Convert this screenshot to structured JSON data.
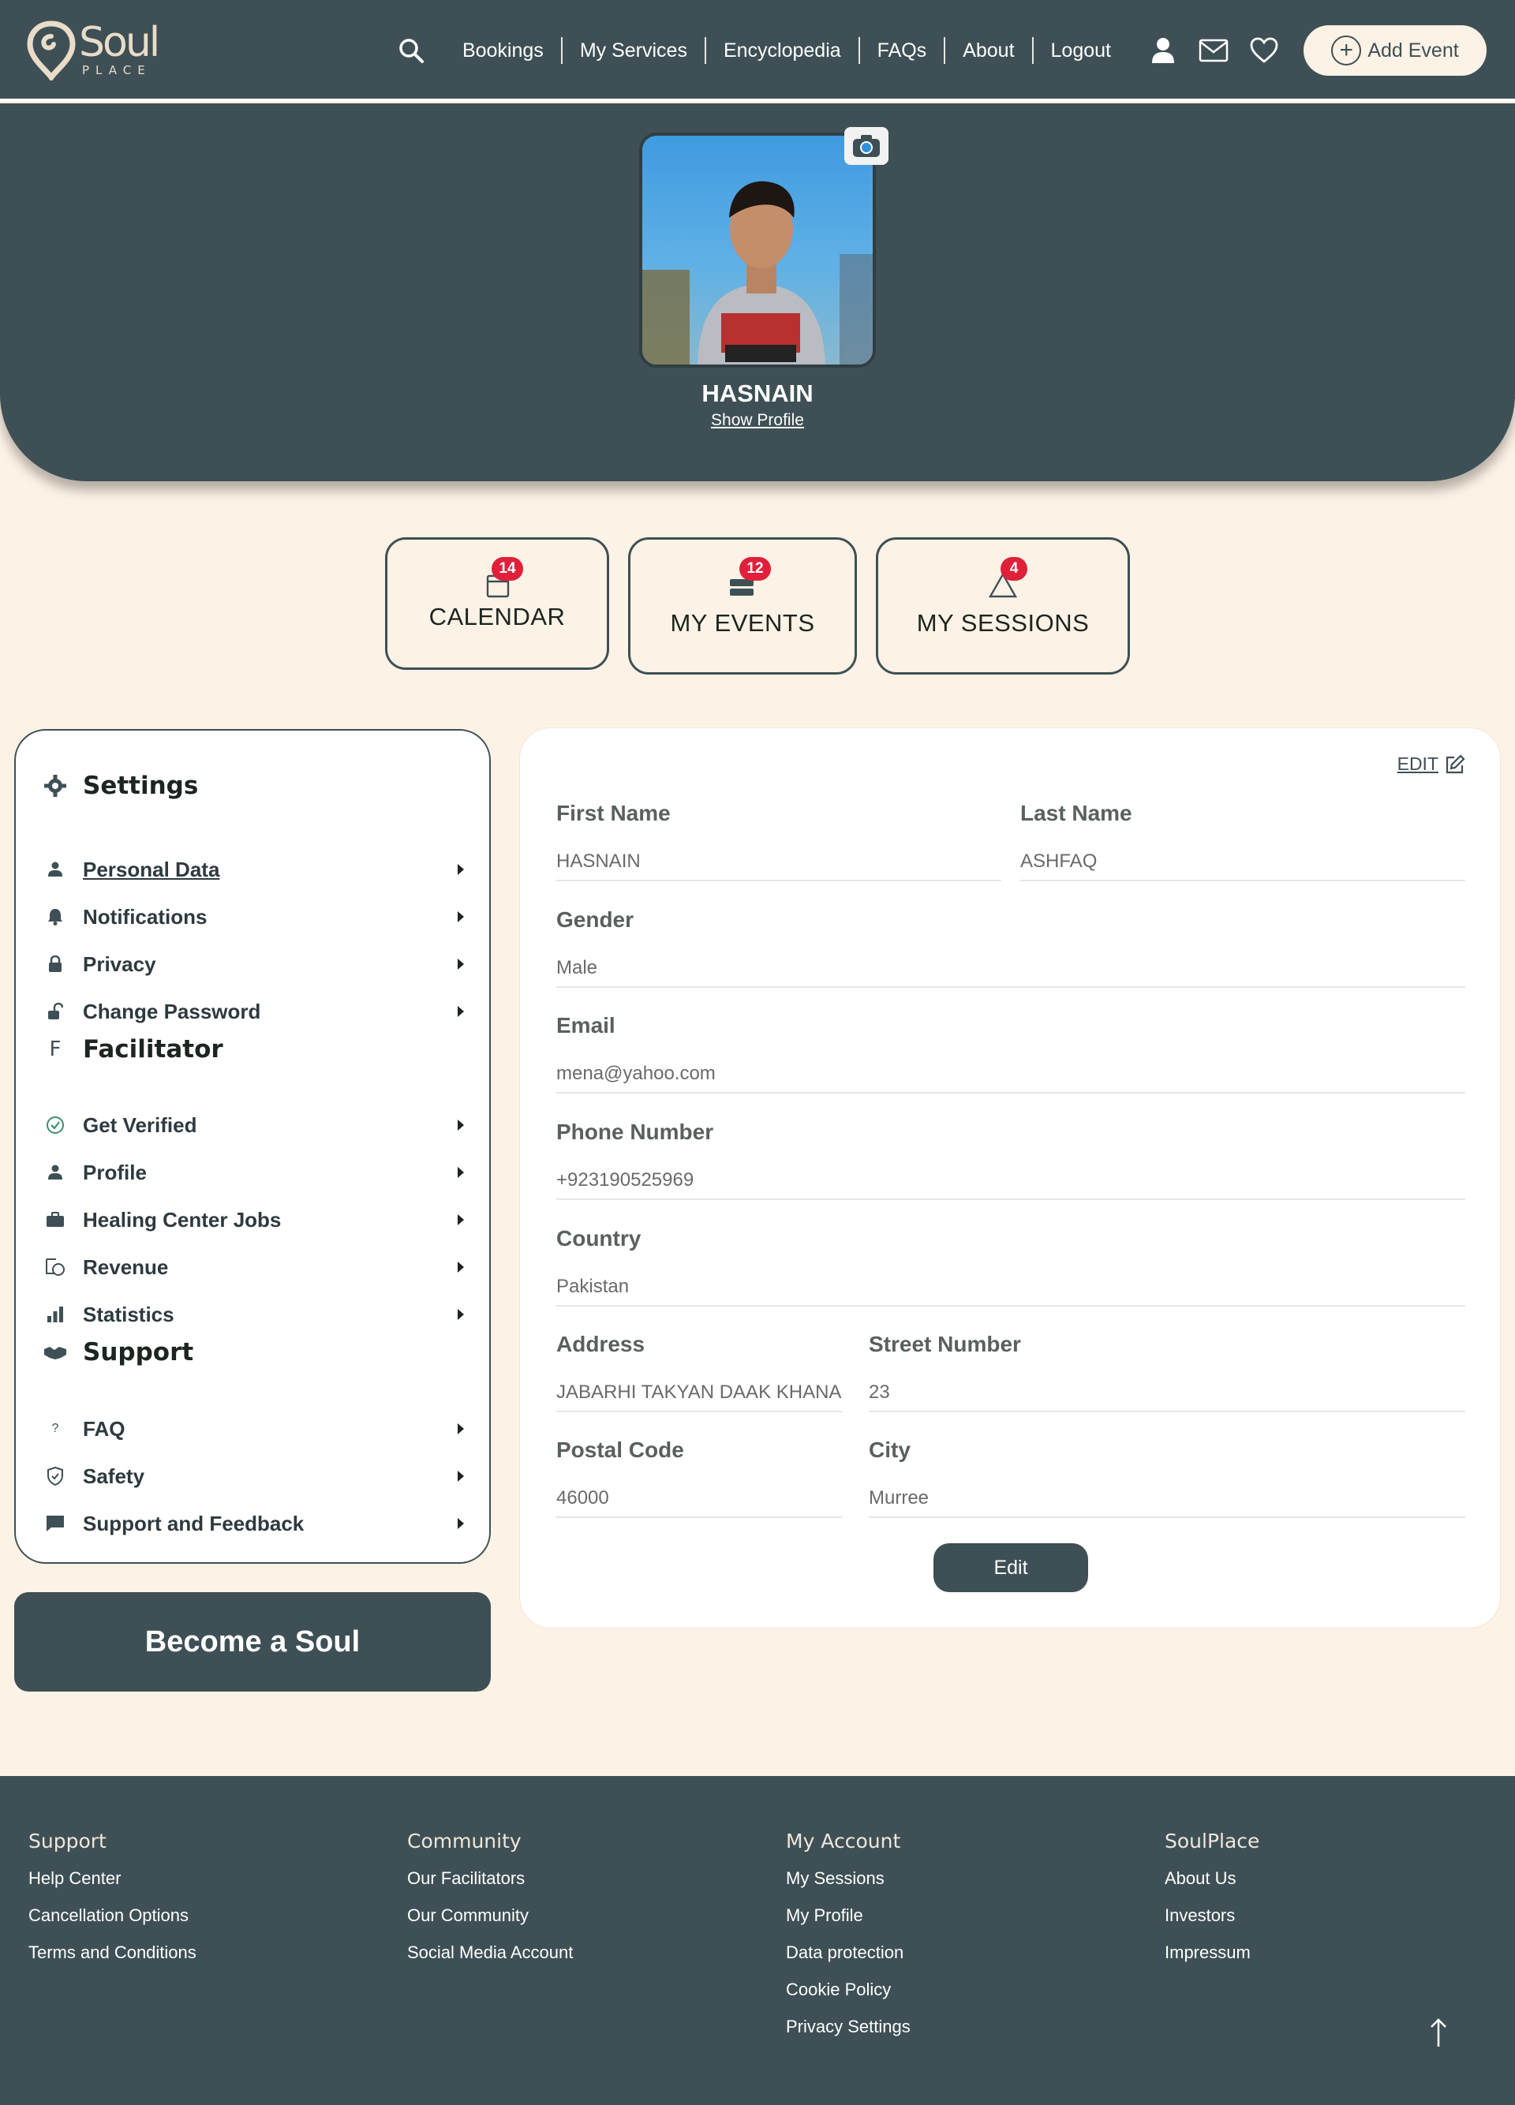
{
  "nav": {
    "logo": {
      "word": "Soul",
      "sub": "PLACE"
    },
    "links": [
      "Bookings",
      "My Services",
      "Encyclopedia",
      "FAQs",
      "About",
      "Logout"
    ],
    "add_event_label": "Add Event"
  },
  "profile": {
    "name": "HASNAIN",
    "show_profile": "Show Profile"
  },
  "stats": {
    "calendar": {
      "label": "CALENDAR",
      "count": "14"
    },
    "events": {
      "label": "MY EVENTS",
      "count": "12"
    },
    "sessions": {
      "label": "MY SESSIONS",
      "count": "4"
    }
  },
  "sidebar": {
    "settings": {
      "title": "Settings",
      "items": [
        "Personal Data",
        "Notifications",
        "Privacy",
        "Change Password"
      ]
    },
    "facilitator": {
      "title": "Facilitator",
      "icon_letter": "F",
      "items": [
        "Get Verified",
        "Profile",
        "Healing Center Jobs",
        "Revenue",
        "Statistics"
      ]
    },
    "support": {
      "title": "Support",
      "items": [
        "FAQ",
        "Safety",
        "Support and Feedback"
      ]
    },
    "faq_icon": "?"
  },
  "become_soul_label": "Become a Soul",
  "form": {
    "edit_link": "EDIT",
    "first_name": {
      "label": "First Name",
      "value": "HASNAIN"
    },
    "last_name": {
      "label": "Last Name",
      "value": "ASHFAQ"
    },
    "gender": {
      "label": "Gender",
      "value": "Male"
    },
    "email": {
      "label": "Email",
      "value": "mena@yahoo.com"
    },
    "phone": {
      "label": "Phone Number",
      "value": "+923190525969"
    },
    "country": {
      "label": "Country",
      "value": "Pakistan"
    },
    "address": {
      "label": "Address",
      "value": "JABARHI TAKYAN DAAK KHANA E"
    },
    "street": {
      "label": "Street Number",
      "value": "23"
    },
    "postal": {
      "label": "Postal Code",
      "value": "46000"
    },
    "city": {
      "label": "City",
      "value": "Murree"
    },
    "edit_button": "Edit"
  },
  "footer": {
    "support": {
      "title": "Support",
      "links": [
        "Help Center",
        "Cancellation Options",
        "Terms and Conditions"
      ]
    },
    "community": {
      "title": "Community",
      "links": [
        "Our Facilitators",
        "Our Community",
        "Social Media Account"
      ]
    },
    "account": {
      "title": "My Account",
      "links": [
        "My Sessions",
        "My Profile",
        "Data protection",
        "Cookie Policy",
        "Privacy Settings"
      ]
    },
    "soulplace": {
      "title": "SoulPlace",
      "links": [
        "About Us",
        "Investors",
        "Impressum"
      ]
    }
  },
  "colors": {
    "primary": "#3e5055",
    "background": "#fdf2e6",
    "badge": "#e0203b"
  }
}
